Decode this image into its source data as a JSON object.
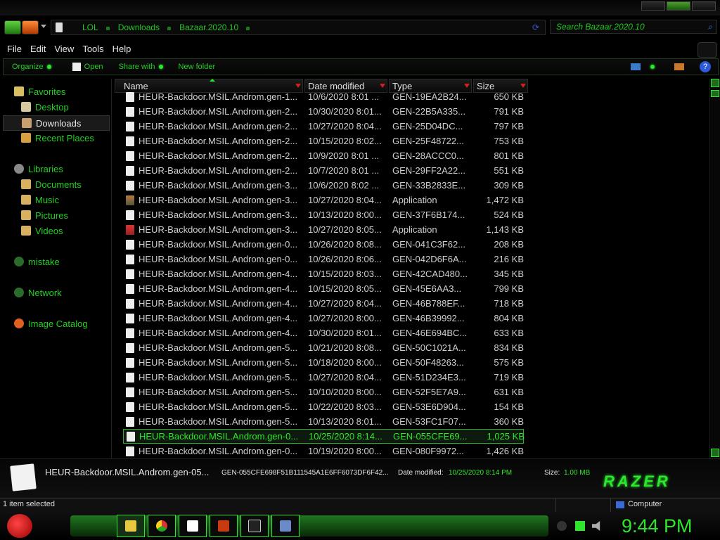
{
  "address": {
    "crumbs": [
      "LOL",
      "Downloads",
      "Bazaar.2020.10"
    ]
  },
  "search": {
    "placeholder": "Search Bazaar.2020.10"
  },
  "menu": [
    "File",
    "Edit",
    "View",
    "Tools",
    "Help"
  ],
  "toolbar": {
    "organize": "Organize",
    "open": "Open",
    "share": "Share with",
    "new_folder": "New folder"
  },
  "sidebar": {
    "favorites": "Favorites",
    "desktop": "Desktop",
    "downloads": "Downloads",
    "recent": "Recent Places",
    "libraries": "Libraries",
    "documents": "Documents",
    "music": "Music",
    "pictures": "Pictures",
    "videos": "Videos",
    "mistake": "mistake",
    "network": "Network",
    "image_catalog": "Image Catalog"
  },
  "columns": {
    "name": "Name",
    "date": "Date modified",
    "type": "Type",
    "size": "Size"
  },
  "files": [
    {
      "name": "HEUR-Backdoor.MSIL.Androm.gen-1...",
      "date": "10/6/2020 8:01 ...",
      "type": "GEN-19EA2B24...",
      "size": "650 KB"
    },
    {
      "name": "HEUR-Backdoor.MSIL.Androm.gen-2...",
      "date": "10/30/2020 8:01...",
      "type": "GEN-22B5A335...",
      "size": "791 KB"
    },
    {
      "name": "HEUR-Backdoor.MSIL.Androm.gen-2...",
      "date": "10/27/2020 8:04...",
      "type": "GEN-25D04DC...",
      "size": "797 KB"
    },
    {
      "name": "HEUR-Backdoor.MSIL.Androm.gen-2...",
      "date": "10/15/2020 8:02...",
      "type": "GEN-25F48722...",
      "size": "753 KB"
    },
    {
      "name": "HEUR-Backdoor.MSIL.Androm.gen-2...",
      "date": "10/9/2020 8:01 ...",
      "type": "GEN-28ACCC0...",
      "size": "801 KB"
    },
    {
      "name": "HEUR-Backdoor.MSIL.Androm.gen-2...",
      "date": "10/7/2020 8:01 ...",
      "type": "GEN-29FF2A22...",
      "size": "551 KB"
    },
    {
      "name": "HEUR-Backdoor.MSIL.Androm.gen-3...",
      "date": "10/6/2020 8:02 ...",
      "type": "GEN-33B2833E...",
      "size": "309 KB"
    },
    {
      "name": "HEUR-Backdoor.MSIL.Androm.gen-3...",
      "date": "10/27/2020 8:04...",
      "type": "Application",
      "size": "1,472 KB"
    },
    {
      "name": "HEUR-Backdoor.MSIL.Androm.gen-3...",
      "date": "10/13/2020 8:00...",
      "type": "GEN-37F6B174...",
      "size": "524 KB"
    },
    {
      "name": "HEUR-Backdoor.MSIL.Androm.gen-3...",
      "date": "10/27/2020 8:05...",
      "type": "Application",
      "size": "1,143 KB"
    },
    {
      "name": "HEUR-Backdoor.MSIL.Androm.gen-0...",
      "date": "10/26/2020 8:08...",
      "type": "GEN-041C3F62...",
      "size": "208 KB"
    },
    {
      "name": "HEUR-Backdoor.MSIL.Androm.gen-0...",
      "date": "10/26/2020 8:06...",
      "type": "GEN-042D6F6A...",
      "size": "216 KB"
    },
    {
      "name": "HEUR-Backdoor.MSIL.Androm.gen-4...",
      "date": "10/15/2020 8:03...",
      "type": "GEN-42CAD480...",
      "size": "345 KB"
    },
    {
      "name": "HEUR-Backdoor.MSIL.Androm.gen-4...",
      "date": "10/15/2020 8:05...",
      "type": "GEN-45E6AA3...",
      "size": "799 KB"
    },
    {
      "name": "HEUR-Backdoor.MSIL.Androm.gen-4...",
      "date": "10/27/2020 8:04...",
      "type": "GEN-46B788EF...",
      "size": "718 KB"
    },
    {
      "name": "HEUR-Backdoor.MSIL.Androm.gen-4...",
      "date": "10/27/2020 8:00...",
      "type": "GEN-46B39992...",
      "size": "804 KB"
    },
    {
      "name": "HEUR-Backdoor.MSIL.Androm.gen-4...",
      "date": "10/30/2020 8:01...",
      "type": "GEN-46E694BC...",
      "size": "633 KB"
    },
    {
      "name": "HEUR-Backdoor.MSIL.Androm.gen-5...",
      "date": "10/21/2020 8:08...",
      "type": "GEN-50C1021A...",
      "size": "834 KB"
    },
    {
      "name": "HEUR-Backdoor.MSIL.Androm.gen-5...",
      "date": "10/18/2020 8:00...",
      "type": "GEN-50F48263...",
      "size": "575 KB"
    },
    {
      "name": "HEUR-Backdoor.MSIL.Androm.gen-5...",
      "date": "10/27/2020 8:04...",
      "type": "GEN-51D234E3...",
      "size": "719 KB"
    },
    {
      "name": "HEUR-Backdoor.MSIL.Androm.gen-5...",
      "date": "10/10/2020 8:00...",
      "type": "GEN-52F5E7A9...",
      "size": "631 KB"
    },
    {
      "name": "HEUR-Backdoor.MSIL.Androm.gen-5...",
      "date": "10/22/2020 8:03...",
      "type": "GEN-53E6D904...",
      "size": "154 KB"
    },
    {
      "name": "HEUR-Backdoor.MSIL.Androm.gen-5...",
      "date": "10/13/2020 8:01...",
      "type": "GEN-53FC1F07...",
      "size": "360 KB"
    },
    {
      "name": "HEUR-Backdoor.MSIL.Androm.gen-0...",
      "date": "10/25/2020 8:14...",
      "type": "GEN-055CFE69...",
      "size": "1,025 KB"
    },
    {
      "name": "HEUR-Backdoor.MSIL.Androm.gen-0...",
      "date": "10/19/2020 8:00...",
      "type": "GEN-080F9972...",
      "size": "1,426 KB"
    }
  ],
  "details": {
    "name": "HEUR-Backdoor.MSIL.Androm.gen-05...",
    "type": "GEN-055CFE698F51B111545A1E6FF6073DF6F42...",
    "date_label": "Date modified:",
    "date_value": "10/25/2020 8:14 PM",
    "size_label": "Size:",
    "size_value": "1.00 MB",
    "brand": "RAZER"
  },
  "status": {
    "left": "1 item selected",
    "right": "Computer"
  },
  "clock": "9:44 PM",
  "colors": {
    "accent": "#2ee62e",
    "bg": "#000000"
  }
}
